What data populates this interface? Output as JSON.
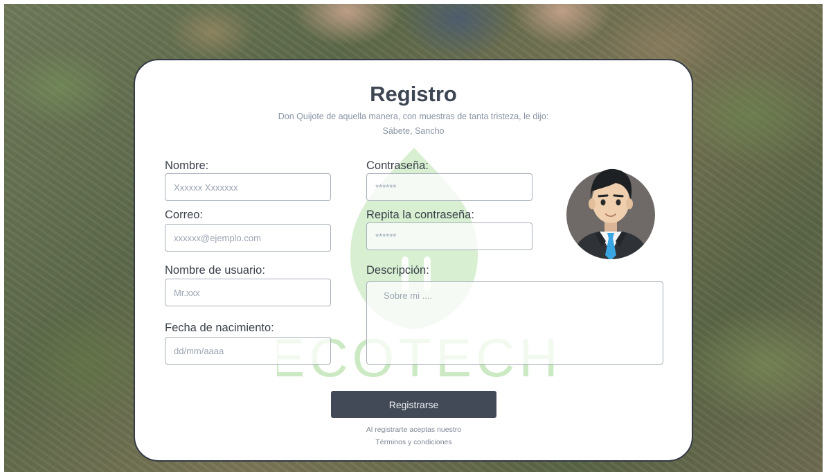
{
  "form": {
    "title": "Registro",
    "subtitle_line1": "Don Quijote de aquella manera, con muestras de tanta tristeza, le dijo:",
    "subtitle_line2": "Sábete, Sancho",
    "fields": {
      "nombre": {
        "label": "Nombre:",
        "placeholder": "Xxxxxx Xxxxxxx",
        "value": ""
      },
      "correo": {
        "label": "Correo:",
        "placeholder": "xxxxxx@ejemplo.com",
        "value": ""
      },
      "usuario": {
        "label": "Nombre de usuario:",
        "placeholder": "Mr.xxx",
        "value": ""
      },
      "fecha": {
        "label": "Fecha de nacimiento:",
        "placeholder": "dd/mm/aaaa",
        "value": ""
      },
      "contrasena": {
        "label": "Contraseña:",
        "placeholder": "******",
        "value": ""
      },
      "repetir": {
        "label": "Repita la contraseña:",
        "placeholder": "******",
        "value": ""
      },
      "descripcion": {
        "label": "Descripción:",
        "placeholder": "Sobre mi ....",
        "value": ""
      }
    },
    "submit_label": "Registrarse",
    "terms_line1": "Al registrarte aceptas nuestro",
    "terms_line2": "Términos y condiciones"
  },
  "watermark": {
    "text": "ECOTECH",
    "color": "#8ed07a"
  },
  "avatar": {
    "icon": "user-avatar-icon",
    "bg_color": "#6f6a68",
    "tie_color": "#39a6e3"
  }
}
